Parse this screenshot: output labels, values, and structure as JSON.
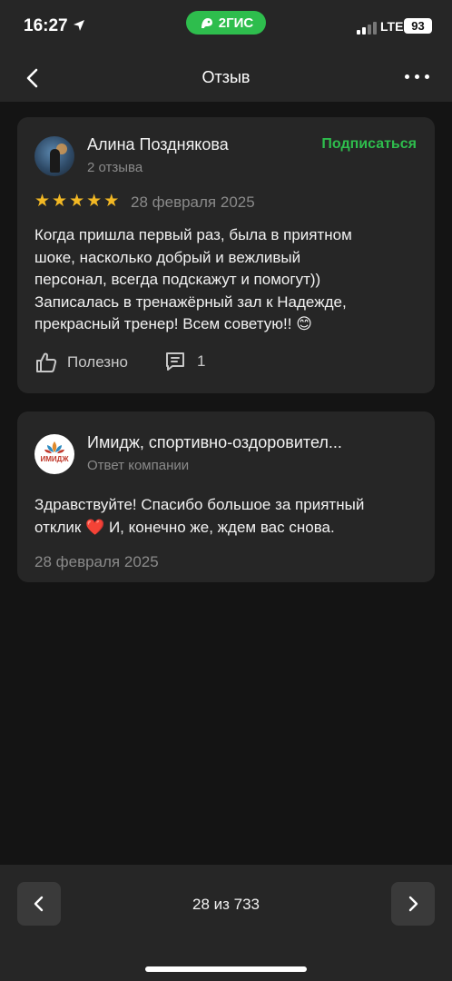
{
  "status": {
    "time": "16:27",
    "brand": "2ГИС",
    "network": "LTE",
    "battery": "93"
  },
  "nav": {
    "title": "Отзыв"
  },
  "review": {
    "author_name": "Алина Позднякова",
    "author_reviews": "2 отзыва",
    "subscribe_label": "Подписаться",
    "rating": 5,
    "stars": "★★★★★",
    "date": "28 февраля 2025",
    "text": "Когда пришла первый раз, была в приятном\nшоке, насколько добрый и вежливый\nперсонал, всегда подскажут и помогут))\nЗаписалась в тренажёрный зал к Надежде,\nпрекрасный тренер! Всем советую!! 😊",
    "useful_label": "Полезно",
    "comments_count": "1"
  },
  "reply": {
    "company_name": "Имидж, спортивно-оздоровител...",
    "company_logo_text": "ИМИДЖ",
    "role": "Ответ компании",
    "text": "Здравствуйте! Спасибо большое за приятный\nотклик ❤️ И, конечно же, ждем вас снова.",
    "date": "28 февраля 2025"
  },
  "pager": {
    "text": "28 из 733"
  },
  "colors": {
    "accent": "#2ebd4d",
    "star": "#f2b824",
    "background": "#141414",
    "card": "#262626"
  }
}
